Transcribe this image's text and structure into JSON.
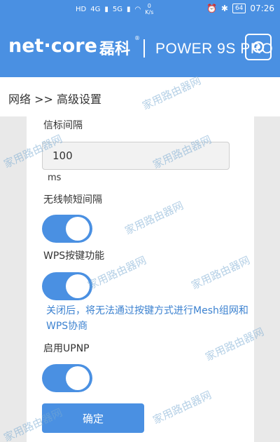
{
  "status_bar": {
    "network_labels": [
      "HD",
      "4G",
      "5G"
    ],
    "speed": "0",
    "speed_unit": "K/s",
    "battery": "64",
    "time": "07:26"
  },
  "header": {
    "brand": "net·core",
    "brand_cn": "磊科",
    "model": "POWER 9S PRO"
  },
  "breadcrumb": "网络 >> 高级设置",
  "settings": {
    "beacon_interval_label": "信标间隔",
    "beacon_interval_value": "100",
    "beacon_interval_unit": "ms",
    "rts_label": "无线帧短间隔",
    "rts_enabled": true,
    "wps_label": "WPS按键功能",
    "wps_enabled": true,
    "wps_warning": "关闭后，将无法通过按键方式进行Mesh组网和WPS协商",
    "upnp_label": "启用UPNP",
    "upnp_enabled": true
  },
  "confirm_label": "确定",
  "watermark": "家用路由器网"
}
